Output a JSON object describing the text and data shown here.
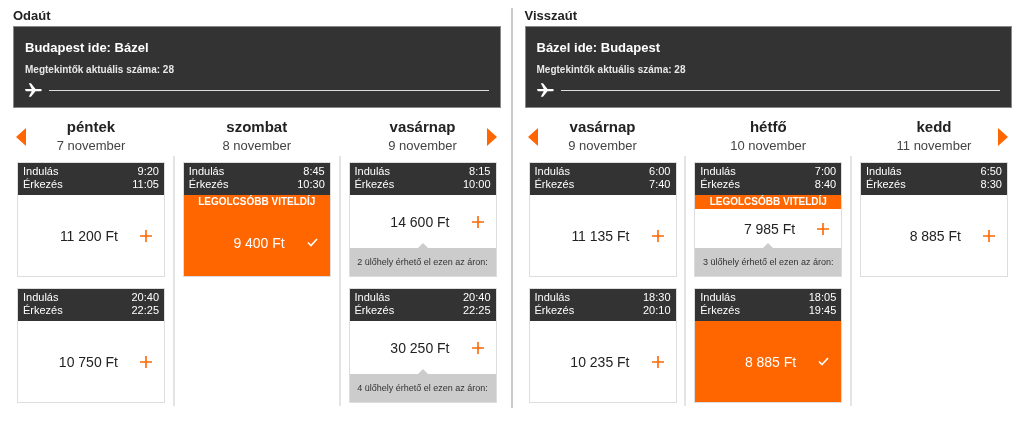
{
  "sections": [
    {
      "title": "Odaút",
      "route": "Budapest ide: Bázel",
      "viewers": "Megtekintők aktuális száma: 28",
      "days": [
        {
          "day": "péntek",
          "date": "7 november",
          "flights": [
            {
              "dep_label": "Indulás",
              "dep": "9:20",
              "arr_label": "Érkezés",
              "arr": "11:05",
              "price": "11 200 Ft",
              "selected": false
            },
            {
              "dep_label": "Indulás",
              "dep": "20:40",
              "arr_label": "Érkezés",
              "arr": "22:25",
              "price": "10 750 Ft",
              "selected": false
            }
          ]
        },
        {
          "day": "szombat",
          "date": "8 november",
          "flights": [
            {
              "dep_label": "Indulás",
              "dep": "8:45",
              "arr_label": "Érkezés",
              "arr": "10:30",
              "badge": "LEGOLCSÓBB VITELDÍJ",
              "price": "9 400 Ft",
              "selected": true
            }
          ]
        },
        {
          "day": "vasárnap",
          "date": "9 november",
          "flights": [
            {
              "dep_label": "Indulás",
              "dep": "8:15",
              "arr_label": "Érkezés",
              "arr": "10:00",
              "price": "14 600 Ft",
              "selected": false,
              "note": "2 ülőhely érhető el ezen az áron:"
            },
            {
              "dep_label": "Indulás",
              "dep": "20:40",
              "arr_label": "Érkezés",
              "arr": "22:25",
              "price": "30 250 Ft",
              "selected": false,
              "note": "4 ülőhely érhető el ezen az áron:"
            }
          ]
        }
      ]
    },
    {
      "title": "Visszaút",
      "route": "Bázel ide: Budapest",
      "viewers": "Megtekintők aktuális száma: 28",
      "days": [
        {
          "day": "vasárnap",
          "date": "9 november",
          "flights": [
            {
              "dep_label": "Indulás",
              "dep": "6:00",
              "arr_label": "Érkezés",
              "arr": "7:40",
              "price": "11 135 Ft",
              "selected": false
            },
            {
              "dep_label": "Indulás",
              "dep": "18:30",
              "arr_label": "Érkezés",
              "arr": "20:10",
              "price": "10 235 Ft",
              "selected": false
            }
          ]
        },
        {
          "day": "hétfő",
          "date": "10 november",
          "flights": [
            {
              "dep_label": "Indulás",
              "dep": "7:00",
              "arr_label": "Érkezés",
              "arr": "8:40",
              "badge": "LEGOLCSÓBB VITELDÍJ",
              "price": "7 985 Ft",
              "selected": false,
              "note": "3 ülőhely érhető el ezen az áron:"
            },
            {
              "dep_label": "Indulás",
              "dep": "18:05",
              "arr_label": "Érkezés",
              "arr": "19:45",
              "price": "8 885 Ft",
              "selected": true
            }
          ]
        },
        {
          "day": "kedd",
          "date": "11 november",
          "flights": [
            {
              "dep_label": "Indulás",
              "dep": "6:50",
              "arr_label": "Érkezés",
              "arr": "8:30",
              "price": "8 885 Ft",
              "selected": false
            }
          ]
        }
      ]
    }
  ]
}
